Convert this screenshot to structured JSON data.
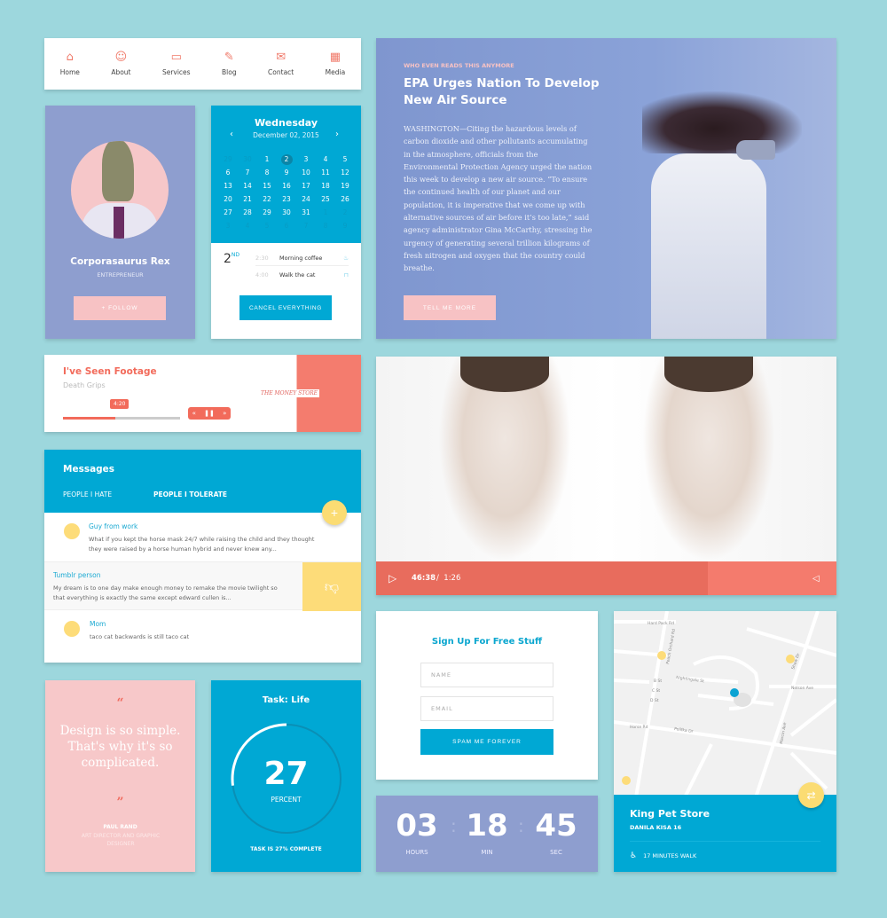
{
  "nav": {
    "items": [
      {
        "label": "Home",
        "icon": "home-icon"
      },
      {
        "label": "About",
        "icon": "user-icon"
      },
      {
        "label": "Services",
        "icon": "briefcase-icon"
      },
      {
        "label": "Blog",
        "icon": "pen-icon"
      },
      {
        "label": "Contact",
        "icon": "envelope-icon"
      },
      {
        "label": "Media",
        "icon": "film-icon"
      }
    ]
  },
  "profile": {
    "name": "Corporasaurus Rex",
    "role": "ENTREPRENEUR",
    "follow": "+ FOLLOW"
  },
  "calendar": {
    "day": "Wednesday",
    "date": "December 02, 2015",
    "prev": "‹",
    "next": "›",
    "days": [
      [
        "29",
        1
      ],
      [
        "30",
        1
      ],
      [
        "1",
        0
      ],
      [
        "2",
        2
      ],
      [
        "3",
        0
      ],
      [
        "4",
        0
      ],
      [
        "5",
        0
      ],
      [
        "6",
        0
      ],
      [
        "7",
        0
      ],
      [
        "8",
        0
      ],
      [
        "9",
        0
      ],
      [
        "10",
        0
      ],
      [
        "11",
        0
      ],
      [
        "12",
        0
      ],
      [
        "13",
        0
      ],
      [
        "14",
        0
      ],
      [
        "15",
        0
      ],
      [
        "16",
        0
      ],
      [
        "17",
        0
      ],
      [
        "18",
        0
      ],
      [
        "19",
        0
      ],
      [
        "20",
        0
      ],
      [
        "21",
        0
      ],
      [
        "22",
        0
      ],
      [
        "23",
        0
      ],
      [
        "24",
        0
      ],
      [
        "25",
        0
      ],
      [
        "26",
        0
      ],
      [
        "27",
        0
      ],
      [
        "28",
        0
      ],
      [
        "29",
        0
      ],
      [
        "30",
        0
      ],
      [
        "31",
        0
      ],
      [
        "1",
        1
      ],
      [
        "2",
        1
      ],
      [
        "3",
        1
      ],
      [
        "4",
        1
      ],
      [
        "5",
        1
      ],
      [
        "6",
        1
      ],
      [
        "7",
        1
      ],
      [
        "8",
        1
      ],
      [
        "9",
        1
      ]
    ],
    "selected_day": "2",
    "suffix": "ND",
    "events": [
      {
        "time": "2:30",
        "label": "Morning coffee",
        "icon": "coffee-icon"
      },
      {
        "time": "4:00",
        "label": "Walk the cat",
        "icon": "basket-icon"
      }
    ],
    "cancel": "CANCEL EVERYTHING"
  },
  "article": {
    "kicker": "WHO EVEN READS THIS ANYMORE",
    "headline": "EPA Urges Nation To Develop New Air Source",
    "body": "WASHINGTON—Citing the hazardous levels of carbon dioxide and other pollutants accumulating in the atmosphere, officials from the Environmental Protection Agency urged the nation this week to develop a new air source. “To ensure the continued health of our planet and our population, it is imperative that we come up with alternative sources of air before it’s too late,” said agency administrator Gina McCarthy, stressing the urgency of generating several trillion kilograms of fresh nitrogen and oxygen that the country could breathe.",
    "cta": "TELL ME MORE"
  },
  "music": {
    "title": "I've Seen Footage",
    "artist": "Death Grips",
    "position": "4:20",
    "progress_pct": 45,
    "album_text": "THE MONEY STORE",
    "controls": {
      "rewind": "«",
      "pause": "❚❚",
      "forward": "»"
    }
  },
  "video": {
    "current": "46:38",
    "separator": "/",
    "duration": "1:26",
    "progress_pct": 72
  },
  "messages": {
    "title": "Messages",
    "tabs": [
      {
        "label": "PEOPLE I HATE"
      },
      {
        "label": "PEOPLE I TOLERATE",
        "active": true
      }
    ],
    "fab": "+",
    "items": [
      {
        "from": "Guy from work",
        "text": "What if you kept the horse mask 24/7 while raising the child  and they thought they were raised by a horse human hybrid and never knew any..."
      },
      {
        "from": "Tumblr person",
        "text": "My dream is to one day make enough money to remake the movie twilight so that everything is exactly the same except edward cullen is..."
      },
      {
        "from": "Mom",
        "text": "taco cat backwards is still taco cat"
      }
    ]
  },
  "quote": {
    "open": "“",
    "text": "Design is so simple. That's why it's so complicated.",
    "close": "”",
    "author": "PAUL RAND",
    "role": "ART DIRECTOR AND GRAPHIC DESIGNER"
  },
  "task": {
    "title": "Task: Life",
    "value": "27",
    "unit": "PERCENT",
    "progress_pct": 27,
    "footer": "TASK IS 27% COMPLETE"
  },
  "signup": {
    "title": "Sign Up For Free Stuff",
    "name_placeholder": "NAME",
    "email_placeholder": "EMAIL",
    "submit": "SPAM ME FOREVER"
  },
  "countdown": {
    "hours": "03",
    "hours_label": "HOURS",
    "min": "18",
    "min_label": "MIN",
    "sec": "45",
    "sec_label": "SEC"
  },
  "map": {
    "name": "King Pet Store",
    "address": "DANILA KISA 16",
    "walk": "17 MINUTES WALK",
    "streets": [
      "Hard Pack Rd",
      "Peach Orchard Rd",
      "Nightingale St",
      "B St",
      "C St",
      "D St",
      "Polifka Dr",
      "Horse Rd",
      "Nelson Ave",
      "Shaw Dr",
      "Marcin Ave"
    ]
  },
  "colors": {
    "background": "#9dd7dd",
    "blue": "#00a8d4",
    "coral": "#f26b5b",
    "pink": "#f7c8c9",
    "periwinkle": "#8e9ecf",
    "yellow": "#fbdc73"
  }
}
